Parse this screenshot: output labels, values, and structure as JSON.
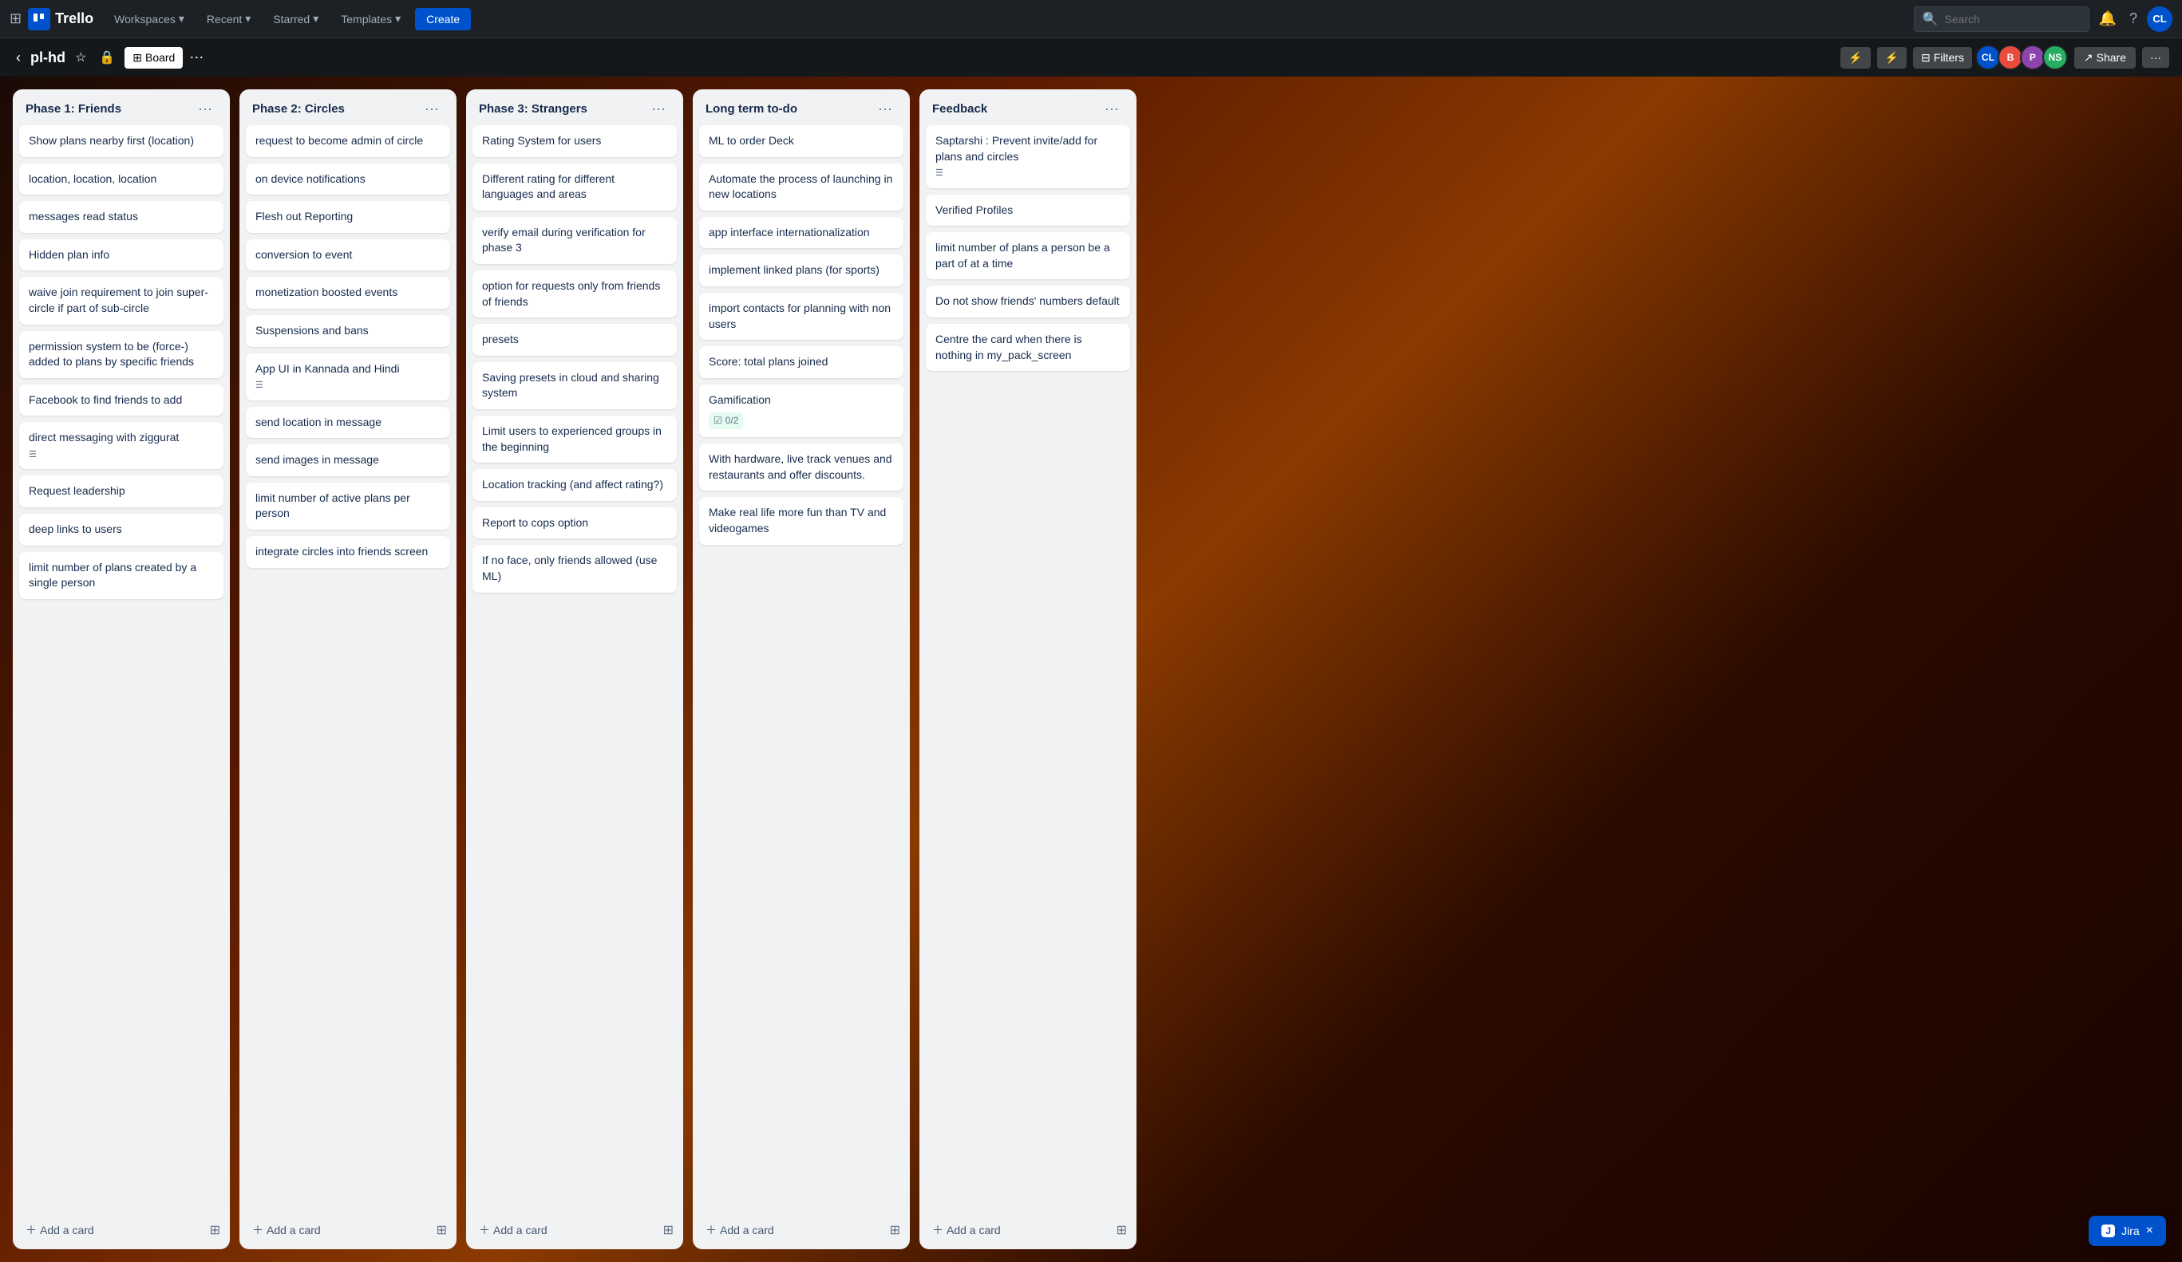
{
  "topNav": {
    "appName": "Trello",
    "workspaces": "Workspaces",
    "recent": "Recent",
    "starred": "Starred",
    "templates": "Templates",
    "create": "Create",
    "searchPlaceholder": "Search",
    "bellIcon": "🔔",
    "helpIcon": "?",
    "avatarInitials": "CL",
    "avatarColor": "#0052cc"
  },
  "boardHeader": {
    "title": "pl-hd",
    "viewLabel": "Board",
    "filtersLabel": "Filters",
    "shareLabel": "Share",
    "moreIcon": "···",
    "members": [
      {
        "initials": "CL",
        "color": "#0052cc"
      },
      {
        "initials": "B",
        "color": "#e74c3c"
      },
      {
        "initials": "NS",
        "color": "#8e44ad"
      }
    ]
  },
  "lists": [
    {
      "id": "phase1",
      "title": "Phase 1: Friends",
      "cards": [
        {
          "text": "Show plans nearby first (location)"
        },
        {
          "text": "location, location, location"
        },
        {
          "text": "messages read status"
        },
        {
          "text": "Hidden plan info"
        },
        {
          "text": "waive join requirement to join super-circle if part of sub-circle"
        },
        {
          "text": "permission system to be (force-) added to plans by specific friends"
        },
        {
          "text": "Facebook to find friends to add"
        },
        {
          "text": "direct messaging with ziggurat",
          "hasDesc": true
        },
        {
          "text": "Request leadership"
        },
        {
          "text": "deep links to users"
        },
        {
          "text": "limit number of plans created by a single person"
        }
      ],
      "addCardLabel": "Add a card"
    },
    {
      "id": "phase2",
      "title": "Phase 2: Circles",
      "cards": [
        {
          "text": "request to become admin of circle"
        },
        {
          "text": "on device notifications"
        },
        {
          "text": "Flesh out Reporting"
        },
        {
          "text": "conversion to event"
        },
        {
          "text": "monetization boosted events"
        },
        {
          "text": "Suspensions and bans"
        },
        {
          "text": "App UI in Kannada and Hindi",
          "hasDesc": true
        },
        {
          "text": "send location in message"
        },
        {
          "text": "send images in message"
        },
        {
          "text": "limit number of active plans per person"
        },
        {
          "text": "integrate circles into friends screen"
        }
      ],
      "addCardLabel": "Add a card"
    },
    {
      "id": "phase3",
      "title": "Phase 3: Strangers",
      "cards": [
        {
          "text": "Rating System for users"
        },
        {
          "text": "Different rating for different languages and areas"
        },
        {
          "text": "verify email during verification for phase 3"
        },
        {
          "text": "option for requests only from friends of friends"
        },
        {
          "text": "presets"
        },
        {
          "text": "Saving presets in cloud and sharing system"
        },
        {
          "text": "Limit users to experienced groups in the beginning"
        },
        {
          "text": "Location tracking (and affect rating?)"
        },
        {
          "text": "Report to cops option"
        },
        {
          "text": "If no face, only friends allowed (use ML)"
        }
      ],
      "addCardLabel": "Add a card"
    },
    {
      "id": "longterm",
      "title": "Long term to-do",
      "cards": [
        {
          "text": "ML to order Deck"
        },
        {
          "text": "Automate the process of launching in new locations"
        },
        {
          "text": "app interface internationalization"
        },
        {
          "text": "implement linked plans (for sports)"
        },
        {
          "text": "import contacts for planning with non users"
        },
        {
          "text": "Score: total plans joined"
        },
        {
          "text": "Gamification",
          "checklist": "0/2"
        },
        {
          "text": "With hardware, live track venues and restaurants and offer discounts."
        },
        {
          "text": "Make real life more fun than TV and videogames"
        }
      ],
      "addCardLabel": "Add a card"
    },
    {
      "id": "feedback",
      "title": "Feedback",
      "cards": [
        {
          "text": "Saptarshi : Prevent invite/add for plans and circles",
          "hasDesc": true
        },
        {
          "text": "Verified Profiles"
        },
        {
          "text": "limit number of plans a person be a part of at a time"
        },
        {
          "text": "Do not show friends' numbers default"
        },
        {
          "text": "Centre the card when there is nothing in my_pack_screen"
        }
      ],
      "addCardLabel": "Add a card"
    }
  ],
  "jiraBadge": {
    "label": "Jira",
    "closeIcon": "×"
  }
}
